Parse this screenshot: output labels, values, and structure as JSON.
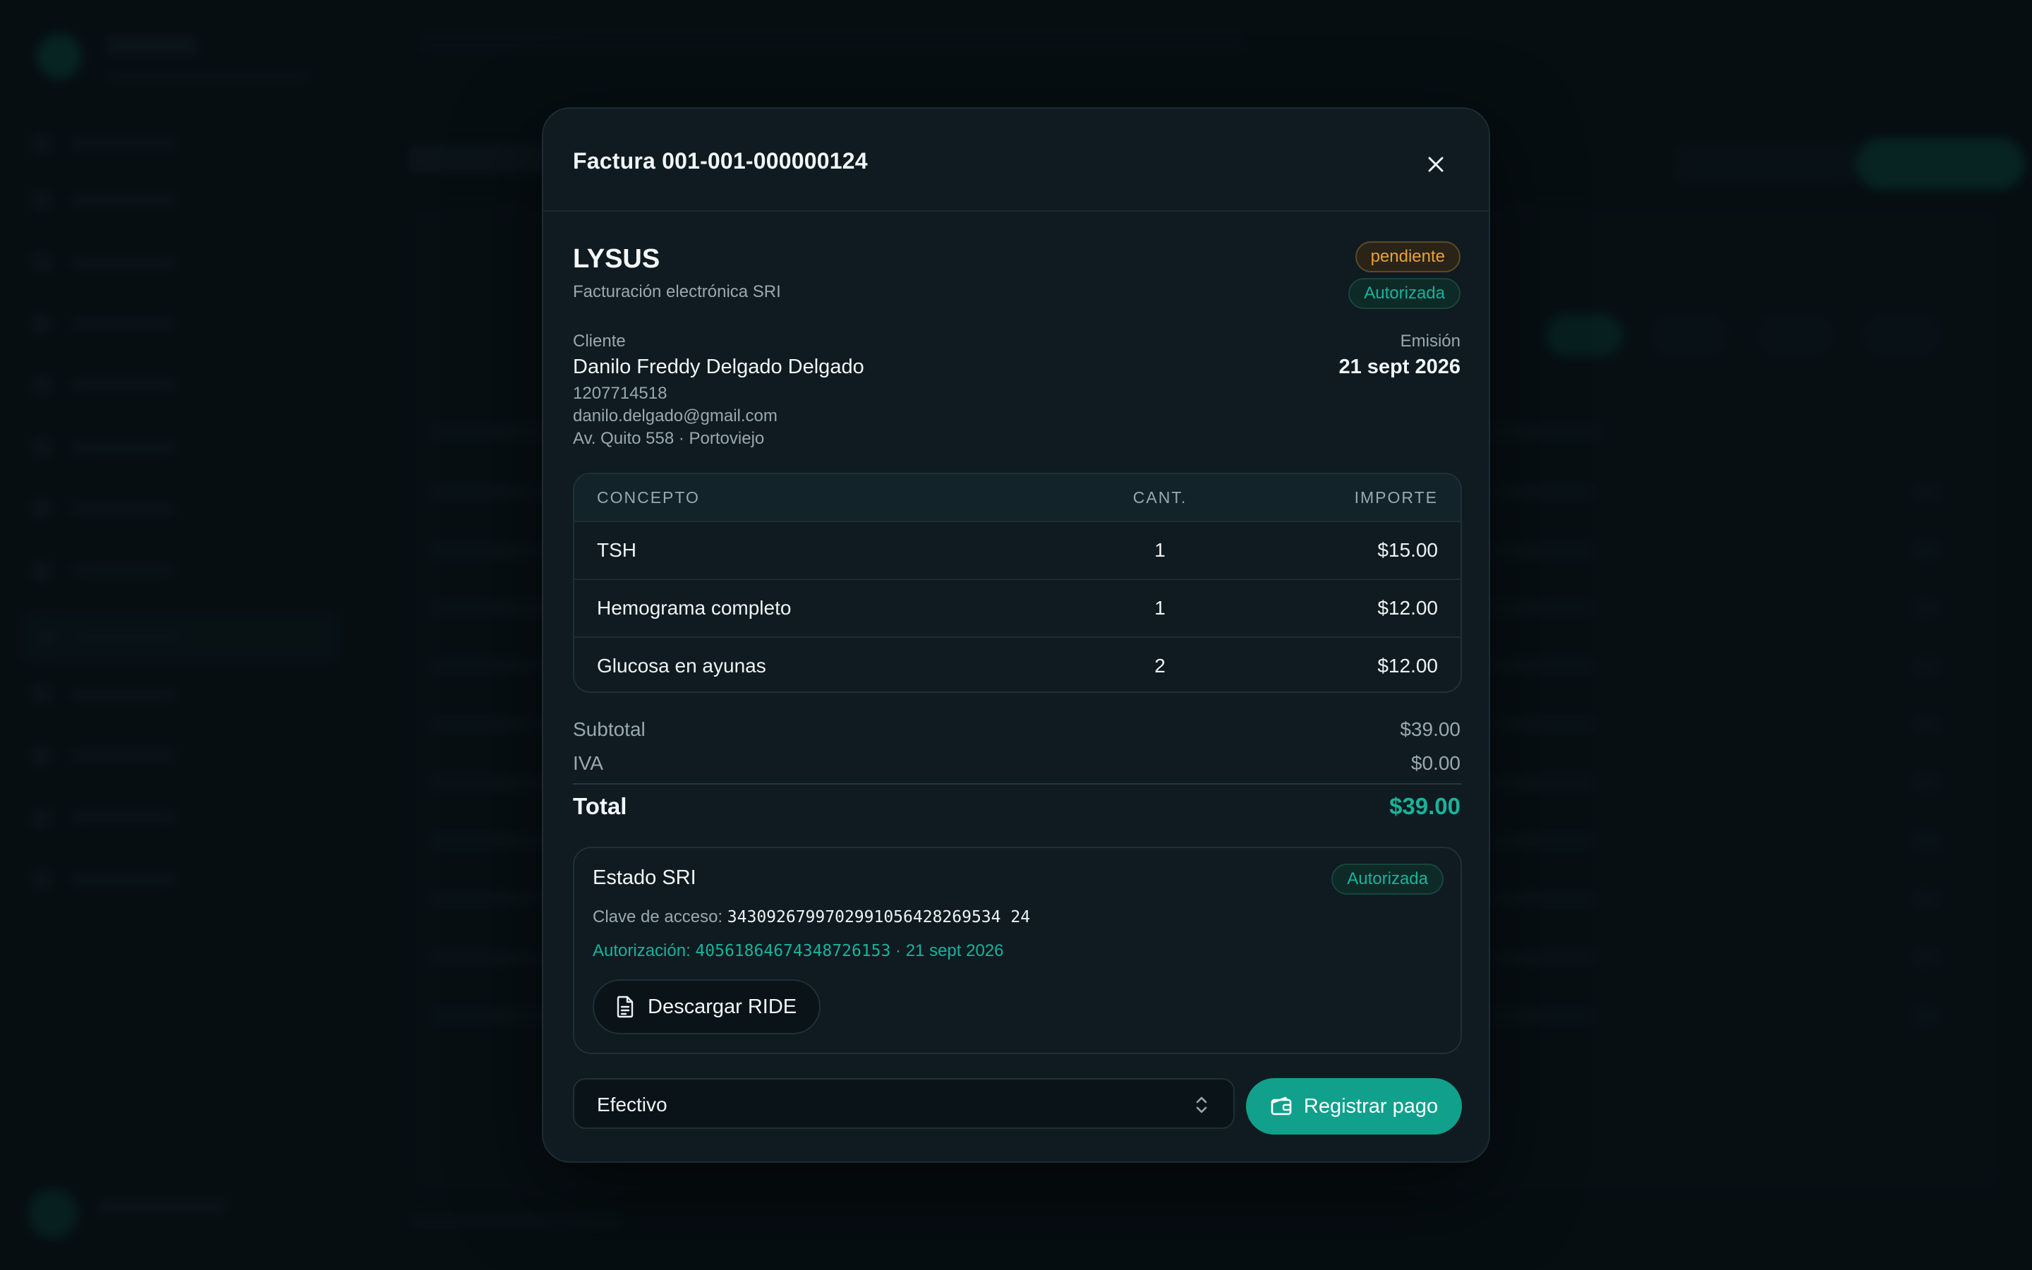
{
  "modal": {
    "title": "Factura 001-001-000000124",
    "close_icon": "close-icon"
  },
  "issuer": {
    "name": "LYSUS",
    "subtitle": "Facturación electrónica SRI"
  },
  "badges": {
    "payment_status": "pendiente",
    "sri_status": "Autorizada"
  },
  "client": {
    "label": "Cliente",
    "name": "Danilo Freddy Delgado Delgado",
    "id": "1207714518",
    "email": "danilo.delgado@gmail.com",
    "address": "Av. Quito 558 · Portoviejo"
  },
  "emission": {
    "label": "Emisión",
    "date": "21 sept 2026"
  },
  "items_table": {
    "headers": [
      "CONCEPTO",
      "CANT.",
      "IMPORTE"
    ],
    "rows": [
      {
        "concept": "TSH",
        "qty": "1",
        "amount": "$15.00"
      },
      {
        "concept": "Hemograma completo",
        "qty": "1",
        "amount": "$12.00"
      },
      {
        "concept": "Glucosa en ayunas",
        "qty": "2",
        "amount": "$12.00"
      }
    ]
  },
  "totals": {
    "subtotal_label": "Subtotal",
    "subtotal": "$39.00",
    "iva_label": "IVA",
    "iva": "$0.00",
    "total_label": "Total",
    "total": "$39.00"
  },
  "sri": {
    "title": "Estado SRI",
    "status": "Autorizada",
    "clave_label": "Clave de acceso:",
    "clave": "3430926799702991056428269534 24",
    "auth_label": "Autorización:",
    "auth_number": "40561864674348726153",
    "auth_date": "· 21 sept 2026",
    "download_label": "Descargar RIDE",
    "download_icon": "document-icon"
  },
  "payment": {
    "method": "Efectivo",
    "method_icon": "chevron-updown-icon",
    "register_label": "Registrar pago",
    "register_icon": "wallet-icon"
  },
  "colors": {
    "accent": "#11a08b",
    "accent_text": "#19b39a",
    "pending": "#e8a13a",
    "modal_bg": "#0f1b21"
  }
}
